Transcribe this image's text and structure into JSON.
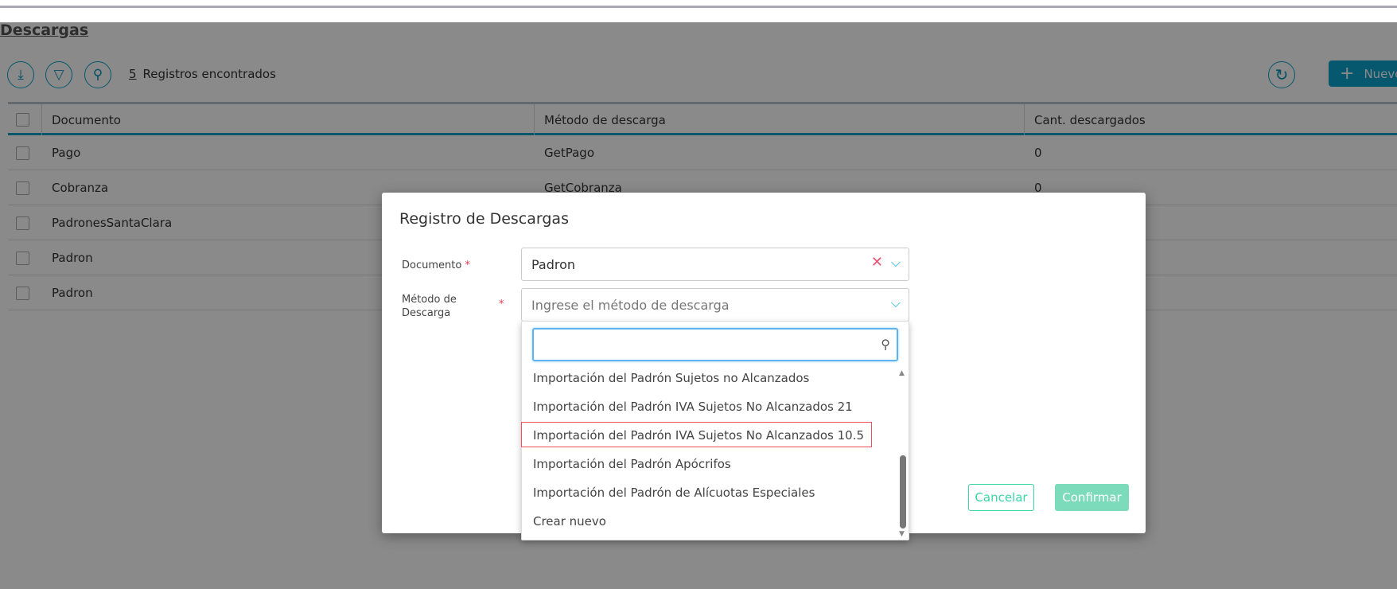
{
  "page": {
    "title": "Descargas",
    "records_count": "5",
    "records_label": "Registros encontrados",
    "new_button": "Nuevo"
  },
  "toolbar_icons": [
    "download-icon",
    "filter-icon",
    "search-icon",
    "refresh-icon"
  ],
  "table": {
    "columns": [
      "Documento",
      "Método de descarga",
      "Cant. descargados"
    ],
    "rows": [
      {
        "documento": "Pago",
        "metodo": "GetPago",
        "cant": "0"
      },
      {
        "documento": "Cobranza",
        "metodo": "GetCobranza",
        "cant": "0"
      },
      {
        "documento": "PadronesSantaClara",
        "metodo": "",
        "cant": ""
      },
      {
        "documento": "Padron",
        "metodo": "",
        "cant": ""
      },
      {
        "documento": "Padron",
        "metodo": "",
        "cant": ""
      }
    ]
  },
  "dialog": {
    "title": "Registro de Descargas",
    "documento_label": "Documento",
    "documento_value": "Padron",
    "metodo_label_1": "Método de",
    "metodo_label_2": "Descarga",
    "required_mark": "*",
    "metodo_placeholder": "Ingrese el método de descarga",
    "search_value": "",
    "options": [
      "Importación del Padrón Sujetos no Alcanzados",
      "Importación del Padrón IVA Sujetos No Alcanzados 21",
      "Importación del Padrón IVA Sujetos No Alcanzados 10.5",
      "Importación del Padrón Apócrifos",
      "Importación del Padrón de Alícuotas Especiales",
      "Crear nuevo"
    ],
    "highlighted_option": "Importación del Padrón IVA Sujetos No Alcanzados 10.5",
    "cancel": "Cancelar",
    "confirm": "Confirmar"
  },
  "colors": {
    "accent": "#0aa3cc",
    "confirm": "#7cdbbb",
    "cancel": "#3bd6a5",
    "highlight": "#ef4f5f"
  }
}
